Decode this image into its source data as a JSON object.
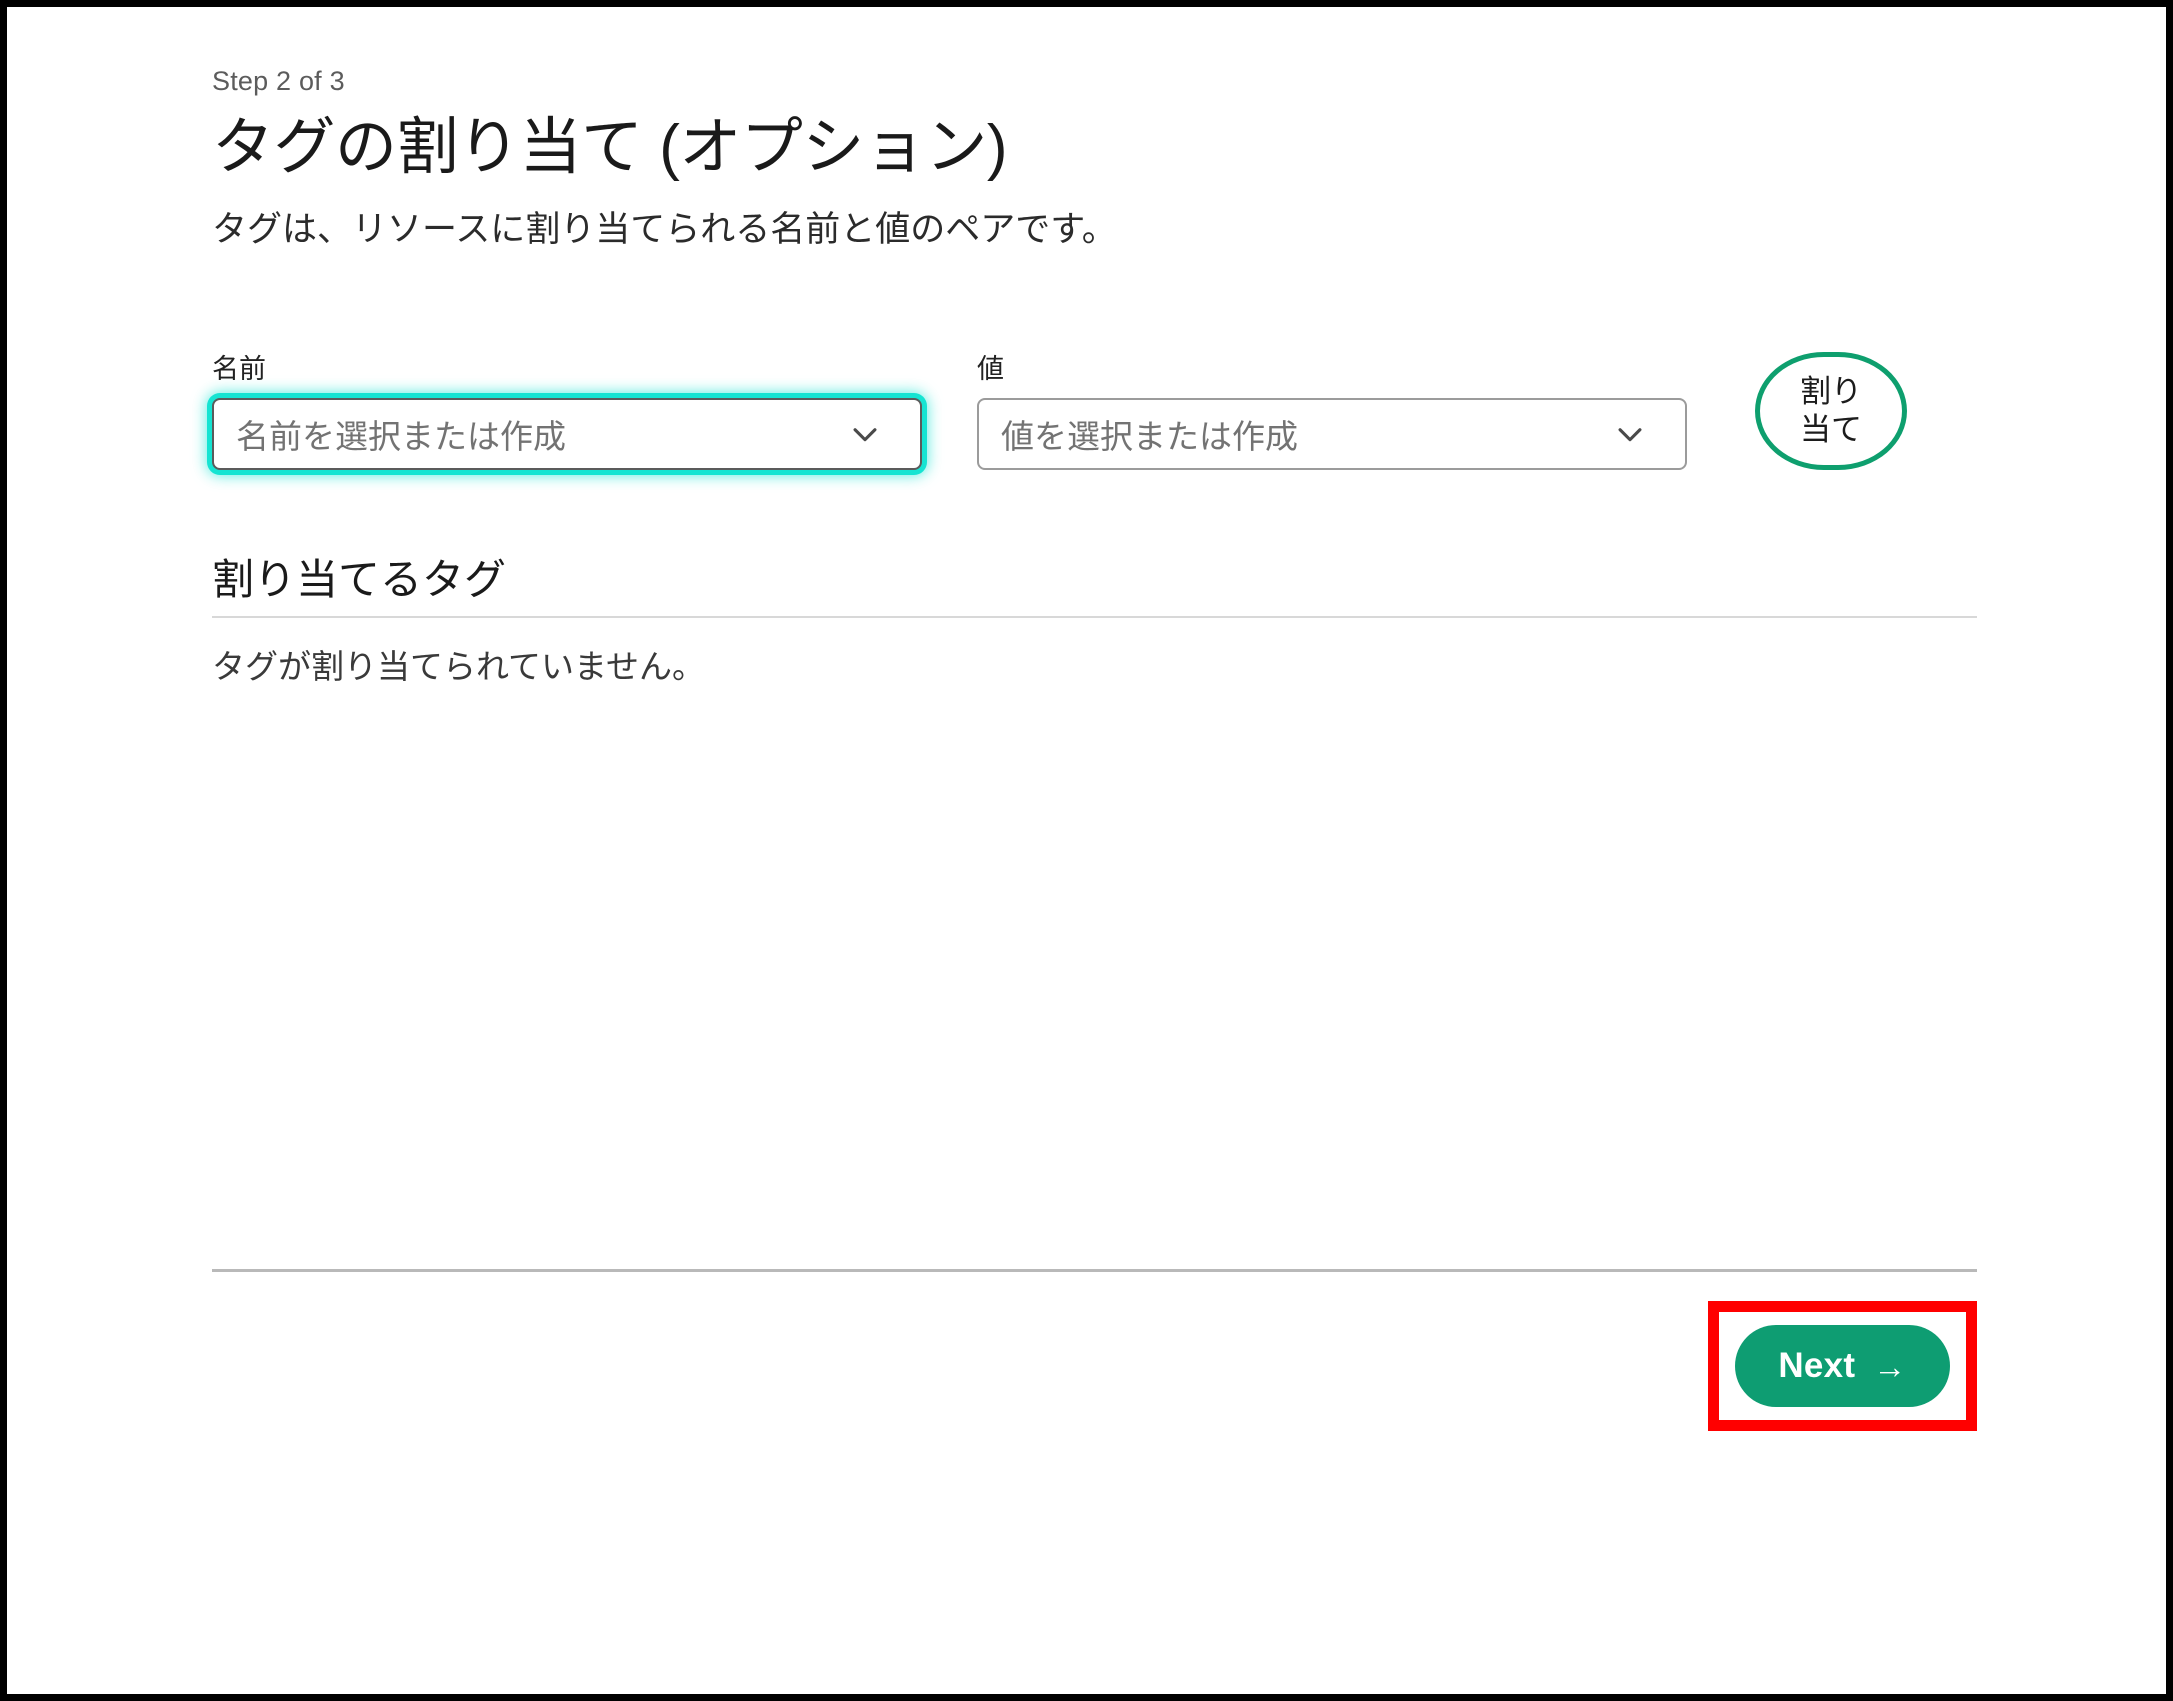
{
  "wizard": {
    "step_label": "Step 2 of 3",
    "title": "タグの割り当て (オプション)",
    "description": "タグは、リソースに割り当てられる名前と値のペアです。"
  },
  "form": {
    "name_field": {
      "label": "名前",
      "placeholder": "名前を選択または作成",
      "value": "",
      "focused": true,
      "chevron_icon": "chevron-down-icon"
    },
    "value_field": {
      "label": "値",
      "placeholder": "値を選択または作成",
      "value": "",
      "focused": false,
      "chevron_icon": "chevron-down-icon"
    },
    "assign_button": {
      "line1": "割り",
      "line2": "当て"
    }
  },
  "assigned_tags": {
    "heading": "割り当てるタグ",
    "empty_message": "タグが割り当てられていません。"
  },
  "footer": {
    "next_button": {
      "label": "Next",
      "arrow": "→"
    }
  },
  "colors": {
    "accent_green": "#0e9d72",
    "assign_border_green": "#0e9f6e",
    "focus_cyan": "#15e4d2",
    "highlight_red": "#ff0000",
    "text_primary": "#1a1a1a",
    "text_muted": "#737373",
    "step_label_gray": "#5c5c5c",
    "divider_gray": "#b9b9b9",
    "heading_rule_gray": "#d8d8d8"
  }
}
